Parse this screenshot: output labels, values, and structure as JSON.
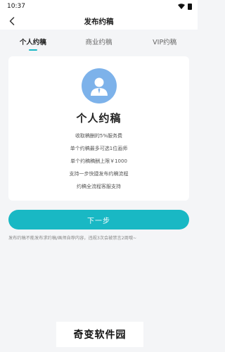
{
  "status_bar": {
    "time": "10:37",
    "icons": [
      "wifi-icon",
      "battery-icon"
    ]
  },
  "nav": {
    "title": "发布约稿",
    "back_icon": "chevron-left-icon"
  },
  "tabs": [
    {
      "label": "个人约稿",
      "active": true
    },
    {
      "label": "商业约稿",
      "active": false
    },
    {
      "label": "VIP约稿",
      "active": false
    }
  ],
  "card": {
    "avatar_icon": "user-avatar-icon",
    "title": "个人约稿",
    "features": [
      "收取稿酬的5%服务费",
      "单个约稿最多可选1位画师",
      "单个约稿稿酬上限￥1000",
      "支持一步快捷发布约稿流程",
      "约稿全流程客服支持"
    ]
  },
  "next_button": {
    "label": "下一步"
  },
  "notice": "发布约稿不能发布求约稿/画师自荐内容，违规3次会被禁言2周哦~",
  "watermark": "奇变软件园",
  "colors": {
    "accent": "#19b8c4",
    "avatar_bg": "#7db2ea",
    "background": "#f4f5f7"
  }
}
